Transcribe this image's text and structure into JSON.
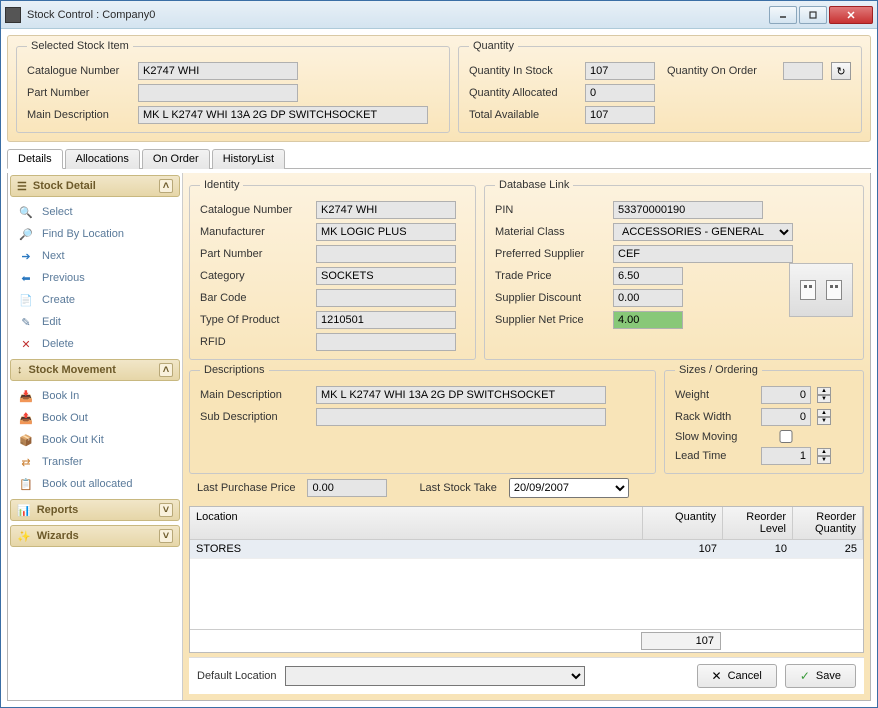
{
  "window": {
    "title": "Stock Control : Company0"
  },
  "selected_stock": {
    "legend": "Selected Stock Item",
    "catalogue_label": "Catalogue Number",
    "catalogue_value": "K2747 WHI",
    "part_label": "Part Number",
    "part_value": "",
    "main_desc_label": "Main Description",
    "main_desc_value": "MK L K2747 WHI 13A 2G DP SWITCHSOCKET"
  },
  "quantity": {
    "legend": "Quantity",
    "in_stock_label": "Quantity In Stock",
    "in_stock_value": "107",
    "on_order_label": "Quantity On Order",
    "on_order_value": "",
    "allocated_label": "Quantity Allocated",
    "allocated_value": "0",
    "total_label": "Total Available",
    "total_value": "107"
  },
  "tabs": [
    "Details",
    "Allocations",
    "On Order",
    "HistoryList"
  ],
  "sidenav": {
    "stock_detail": {
      "title": "Stock Detail",
      "items": [
        "Select",
        "Find By Location",
        "Next",
        "Previous",
        "Create",
        "Edit",
        "Delete"
      ]
    },
    "stock_movement": {
      "title": "Stock Movement",
      "items": [
        "Book In",
        "Book Out",
        "Book Out Kit",
        "Transfer",
        "Book out allocated"
      ]
    },
    "reports": {
      "title": "Reports"
    },
    "wizards": {
      "title": "Wizards"
    }
  },
  "identity": {
    "legend": "Identity",
    "catalogue_label": "Catalogue Number",
    "catalogue_value": "K2747 WHI",
    "manufacturer_label": "Manufacturer",
    "manufacturer_value": "MK LOGIC PLUS",
    "part_label": "Part Number",
    "part_value": "",
    "category_label": "Category",
    "category_value": "SOCKETS",
    "barcode_label": "Bar Code",
    "barcode_value": "",
    "type_label": "Type Of Product",
    "type_value": "1210501",
    "rfid_label": "RFID",
    "rfid_value": ""
  },
  "dblink": {
    "legend": "Database Link",
    "pin_label": "PIN",
    "pin_value": "53370000190",
    "material_label": "Material Class",
    "material_value": "ACCESSORIES - GENERAL",
    "supplier_label": "Preferred Supplier",
    "supplier_value": "CEF",
    "trade_label": "Trade Price",
    "trade_value": "6.50",
    "discount_label": "Supplier Discount",
    "discount_value": "0.00",
    "net_label": "Supplier Net Price",
    "net_value": "4.00"
  },
  "descriptions": {
    "legend": "Descriptions",
    "main_label": "Main Description",
    "main_value": "MK L K2747 WHI 13A 2G DP SWITCHSOCKET",
    "sub_label": "Sub Description",
    "sub_value": ""
  },
  "sizes": {
    "legend": "Sizes / Ordering",
    "weight_label": "Weight",
    "weight_value": "0",
    "rack_label": "Rack Width",
    "rack_value": "0",
    "slow_label": "Slow Moving",
    "lead_label": "Lead Time",
    "lead_value": "1"
  },
  "purchase": {
    "last_price_label": "Last Purchase Price",
    "last_price_value": "0.00",
    "last_take_label": "Last Stock Take",
    "last_take_value": "20/09/2007"
  },
  "loc_table": {
    "headers": {
      "loc": "Location",
      "qty": "Quantity",
      "rl": "Reorder Level",
      "rq": "Reorder Quantity"
    },
    "rows": [
      {
        "loc": "STORES",
        "qty": "107",
        "rl": "10",
        "rq": "25"
      }
    ],
    "footer_qty": "107"
  },
  "bottom": {
    "default_loc_label": "Default Location",
    "cancel": "Cancel",
    "save": "Save"
  }
}
